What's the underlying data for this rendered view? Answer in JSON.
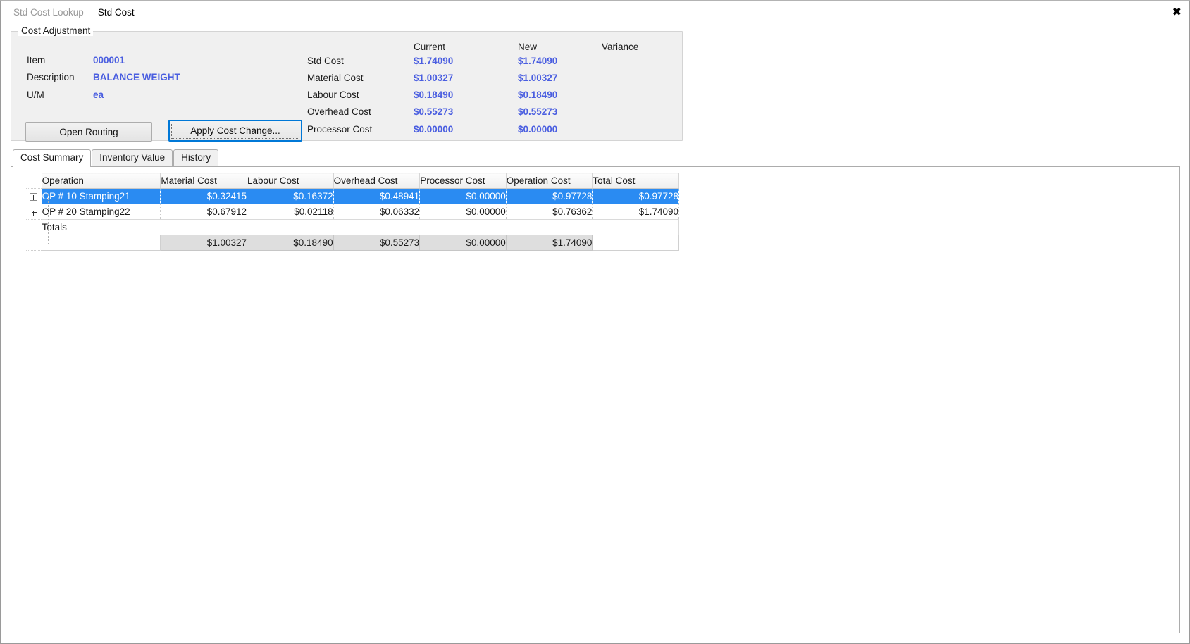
{
  "window": {
    "close_label": "✖"
  },
  "top_tabs": [
    {
      "label": "Std Cost Lookup",
      "active": false
    },
    {
      "label": "Std Cost",
      "active": true
    }
  ],
  "cost_adjustment": {
    "legend": "Cost Adjustment",
    "fields": [
      {
        "label": "Item",
        "value": "000001"
      },
      {
        "label": "Description",
        "value": "BALANCE WEIGHT"
      },
      {
        "label": "U/M",
        "value": "ea"
      }
    ],
    "column_headers": [
      "Current",
      "New",
      "Variance"
    ],
    "rows": [
      {
        "label": "Std Cost",
        "current": "$1.74090",
        "new": "$1.74090",
        "variance": ""
      },
      {
        "label": "Material Cost",
        "current": "$1.00327",
        "new": "$1.00327",
        "variance": ""
      },
      {
        "label": "Labour Cost",
        "current": "$0.18490",
        "new": "$0.18490",
        "variance": ""
      },
      {
        "label": "Overhead Cost",
        "current": "$0.55273",
        "new": "$0.55273",
        "variance": ""
      },
      {
        "label": "Processor Cost",
        "current": "$0.00000",
        "new": "$0.00000",
        "variance": ""
      }
    ],
    "buttons": {
      "open_routing": "Open Routing",
      "apply_cost_change": "Apply Cost Change..."
    },
    "value_color": "#4a5ee0"
  },
  "lower_tabs": [
    {
      "label": "Cost Summary",
      "active": true
    },
    {
      "label": "Inventory Value",
      "active": false
    },
    {
      "label": "History",
      "active": false
    }
  ],
  "grid": {
    "columns": [
      "Operation",
      "Material Cost",
      "Labour Cost",
      "Overhead Cost",
      "Processor Cost",
      "Operation Cost",
      "Total Cost"
    ],
    "rows": [
      {
        "expander": "plus-icon",
        "operation": "OP # 10 Stamping21",
        "material_cost": "$0.32415",
        "labour_cost": "$0.16372",
        "overhead_cost": "$0.48941",
        "processor_cost": "$0.00000",
        "operation_cost": "$0.97728",
        "total_cost": "$0.97728",
        "selected": true
      },
      {
        "expander": "plus-icon",
        "operation": "OP # 20 Stamping22",
        "material_cost": "$0.67912",
        "labour_cost": "$0.02118",
        "overhead_cost": "$0.06332",
        "processor_cost": "$0.00000",
        "operation_cost": "$0.76362",
        "total_cost": "$1.74090",
        "selected": false
      }
    ],
    "totals_label": "Totals",
    "totals": {
      "operation": "",
      "material_cost": "$1.00327",
      "labour_cost": "$0.18490",
      "overhead_cost": "$0.55273",
      "processor_cost": "$0.00000",
      "operation_cost": "$1.74090",
      "total_cost": ""
    },
    "selection_color": "#2a8bf2"
  }
}
